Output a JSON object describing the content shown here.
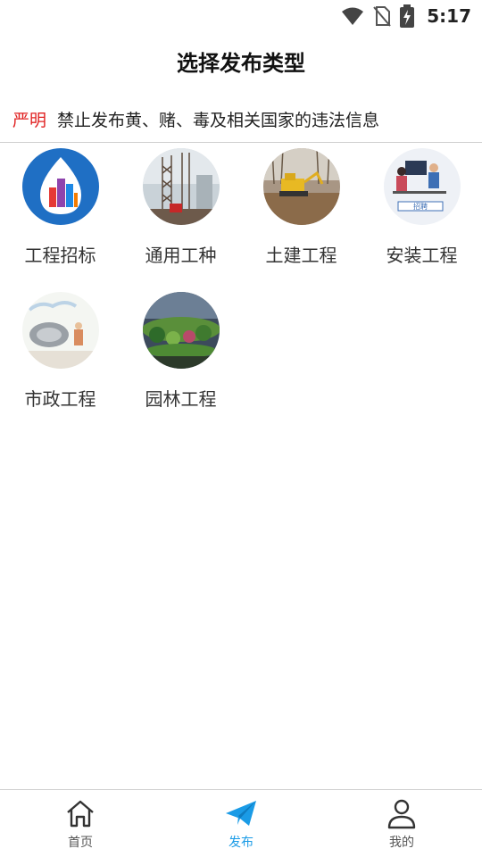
{
  "status_bar": {
    "time": "5:17",
    "icons": [
      "wifi-icon",
      "no-sim-icon",
      "battery-charging-icon"
    ]
  },
  "header": {
    "title": "选择发布类型"
  },
  "notice": {
    "tag": "严明",
    "text": "禁止发布黄、赌、毒及相关国家的违法信息",
    "tag_color": "#e02020"
  },
  "categories": [
    {
      "label": "工程招标",
      "icon": "bidding-icon"
    },
    {
      "label": "通用工种",
      "icon": "general-work-icon"
    },
    {
      "label": "土建工程",
      "icon": "civil-engineering-icon"
    },
    {
      "label": "安装工程",
      "icon": "installation-icon"
    },
    {
      "label": "市政工程",
      "icon": "municipal-icon"
    },
    {
      "label": "园林工程",
      "icon": "landscape-icon"
    }
  ],
  "bottom_nav": {
    "active_color": "#1a9be6",
    "items": [
      {
        "label": "首页",
        "icon": "home-icon",
        "active": false
      },
      {
        "label": "发布",
        "icon": "paper-plane-icon",
        "active": true
      },
      {
        "label": "我的",
        "icon": "profile-icon",
        "active": false
      }
    ]
  }
}
